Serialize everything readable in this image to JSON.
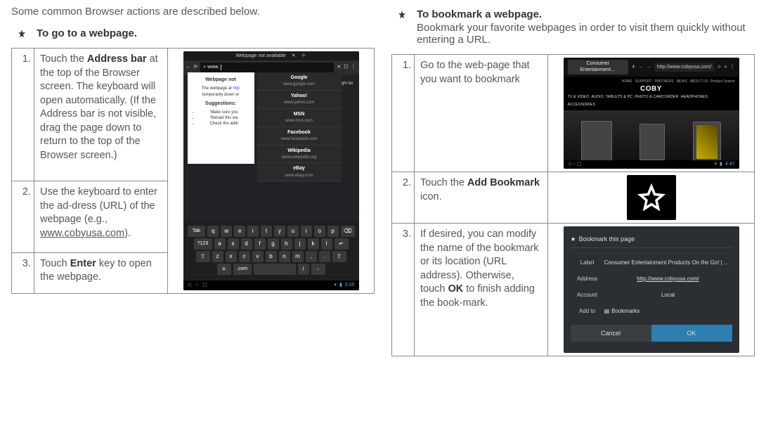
{
  "intro": "Some common Browser actions are described below.",
  "left": {
    "title": "To go to a webpage.",
    "steps": [
      {
        "num": "1.",
        "html_parts": [
          "Touch the ",
          "Address bar",
          " at the top of the Browser screen. The keyboard will open automatically. (If the Address bar is not visible, drag the page down to return to the top of the Browser screen.)"
        ]
      },
      {
        "num": "2.",
        "html_parts": [
          "Use the keyboard to enter the ad-dress (URL) of the webpage (e.g., ",
          "www.cobyusa.com",
          ")."
        ]
      },
      {
        "num": "3.",
        "html_parts": [
          "Touch ",
          "Enter",
          " key to open the webpage."
        ]
      }
    ],
    "screenshot": {
      "tab_label": "Webpage not available",
      "addr_input": "www.",
      "panel_header": "Webpage not",
      "panel_line": "The webpage at",
      "panel_status": "temporarily down or",
      "panel_might": "might be",
      "panel_suggestions_label": "Suggestions:",
      "panel_suggestions": [
        "Make sure you",
        "Reload this we",
        "Check the addr"
      ],
      "suggestions": [
        {
          "title": "Google",
          "sub": "www.google.com"
        },
        {
          "title": "Yahoo!",
          "sub": "www.yahoo.com"
        },
        {
          "title": "MSN",
          "sub": "www.msn.com"
        },
        {
          "title": "Facebook",
          "sub": "www.facebook.com"
        },
        {
          "title": "Wikipedia",
          "sub": "www.wikipedia.org"
        },
        {
          "title": "eBay",
          "sub": "www.ebay.com"
        }
      ],
      "keys_row1_left": "Tab",
      "keys_row1": [
        "q",
        "w",
        "e",
        "r",
        "t",
        "y",
        "u",
        "i",
        "o",
        "p"
      ],
      "keys_row2_left": "?123",
      "keys_row2": [
        "a",
        "s",
        "d",
        "f",
        "g",
        "h",
        "j",
        "k",
        "l"
      ],
      "keys_row3": [
        "z",
        "x",
        "c",
        "v",
        "b",
        "n",
        "m",
        ",",
        "."
      ],
      "keys_row4_com": ".com",
      "keys_row4_slash": "/",
      "clock": "5:05"
    }
  },
  "right": {
    "title": "To bookmark a webpage.",
    "desc": "Bookmark your favorite webpages in order to visit them quickly without entering a URL.",
    "steps": [
      {
        "num": "1.",
        "text": "Go to the web-page that you want to bookmark"
      },
      {
        "num": "2.",
        "html_parts": [
          "Touch the ",
          "Add Bookmark",
          " icon."
        ]
      },
      {
        "num": "3.",
        "html_parts": [
          "If desired, you can modify the name of the bookmark or its location (URL address). Otherwise, touch ",
          "OK",
          " to finish adding the book-mark."
        ]
      }
    ],
    "coby": {
      "tab": "Consumer Entertainment…",
      "url": "http://www.cobyusa.com/",
      "logo": "COBY",
      "topnav": [
        "HOME",
        "SUPPORT",
        "PARTNERS",
        "NEWS",
        "ABOUT US",
        "Product Search"
      ],
      "nav": [
        "TV & VIDEO",
        "AUDIO",
        "TABLETS & PC",
        "PHOTO & CAMCORDER",
        "HEADPHONES",
        "ACCESSORIES"
      ],
      "clock": "4:47"
    },
    "bookmark_dialog": {
      "title": "Bookmark this page",
      "label_l": "Label",
      "label_v": "Consumer Entertainment Products On the Go! | COBY",
      "addr_l": "Address",
      "addr_v": "http://www.cobyusa.com/",
      "acct_l": "Account",
      "acct_v": "Local",
      "addto_l": "Add to",
      "addto_v": "Bookmarks",
      "cancel": "Cancel",
      "ok": "OK"
    }
  }
}
